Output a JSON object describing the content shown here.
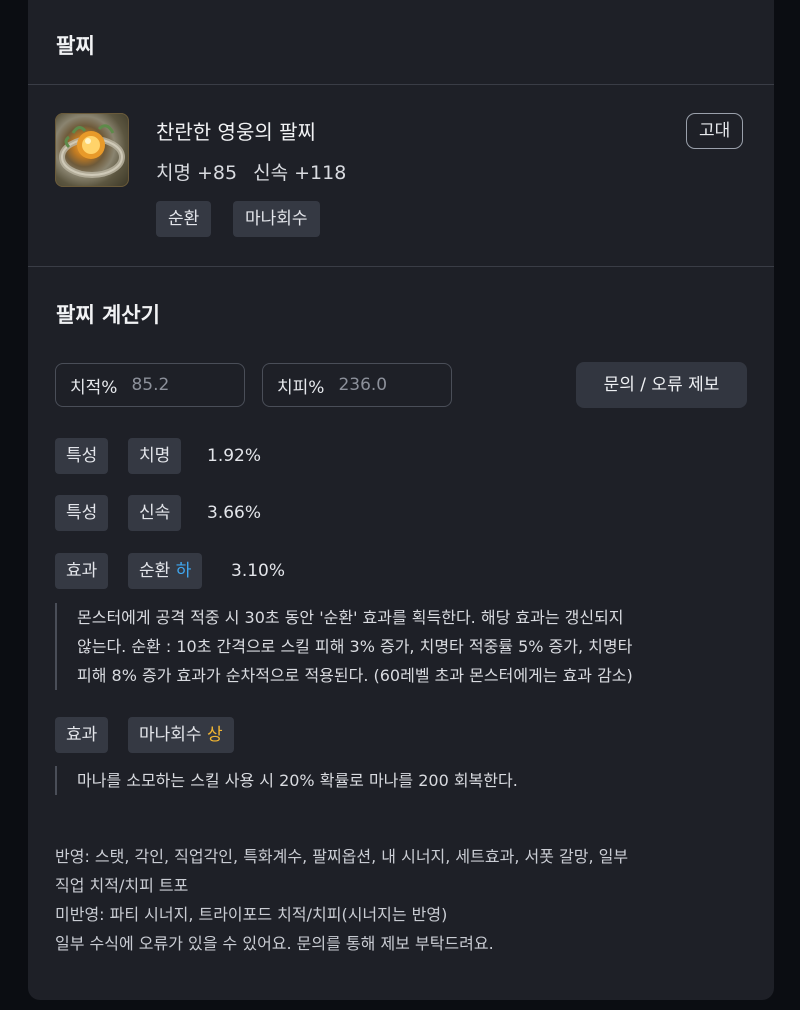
{
  "section_bracelet": "팔찌",
  "item": {
    "name": "찬란한 영웅의 팔찌",
    "grade": "고대",
    "stats": [
      "치명 +85",
      "신속 +118"
    ],
    "tags": [
      "순환",
      "마나회수"
    ],
    "icon": "bracelet-item-icon"
  },
  "calculator": {
    "title": "팔찌 계산기",
    "crit_rate_label": "치적%",
    "crit_rate_value": "85.2",
    "crit_dmg_label": "치피%",
    "crit_dmg_value": "236.0",
    "report_button": "문의 / 오류 제보",
    "rows": [
      {
        "type": "특성",
        "name": "치명",
        "value": "1.92%"
      },
      {
        "type": "특성",
        "name": "신속",
        "value": "3.66%"
      },
      {
        "type": "효과",
        "name": "순환",
        "grade": "하",
        "grade_color": "#3fa7f0",
        "value": "3.10%",
        "desc": [
          "몬스터에게 공격 적중 시 30초 동안 '순환' 효과를 획득한다. 해당 효과는 갱신되지",
          "않는다. 순환 : 10초 간격으로 스킬 피해 3% 증가, 치명타 적중률 5% 증가, 치명타",
          "피해 8% 증가 효과가 순차적으로 적용된다. (60레벨 초과 몬스터에게는 효과 감소)"
        ]
      },
      {
        "type": "효과",
        "name": "마나회수",
        "grade": "상",
        "grade_color": "#f2b632",
        "desc": [
          "마나를 소모하는 스킬 사용 시 20% 확률로 마나를 200 회복한다."
        ]
      }
    ]
  },
  "notes": [
    "반영: 스탯, 각인, 직업각인, 특화계수, 팔찌옵션, 내 시너지, 세트효과, 서폿 갈망, 일부",
    "직업 치적/치피 트포",
    "미반영: 파티 시너지, 트라이포드 치적/치피(시너지는 반영)",
    "일부 수식에 오류가 있을 수 있어요. 문의를 통해 제보 부탁드려요."
  ],
  "colors": {
    "background": "#0b0d12",
    "card": "#1e2027",
    "chip": "#353943"
  }
}
